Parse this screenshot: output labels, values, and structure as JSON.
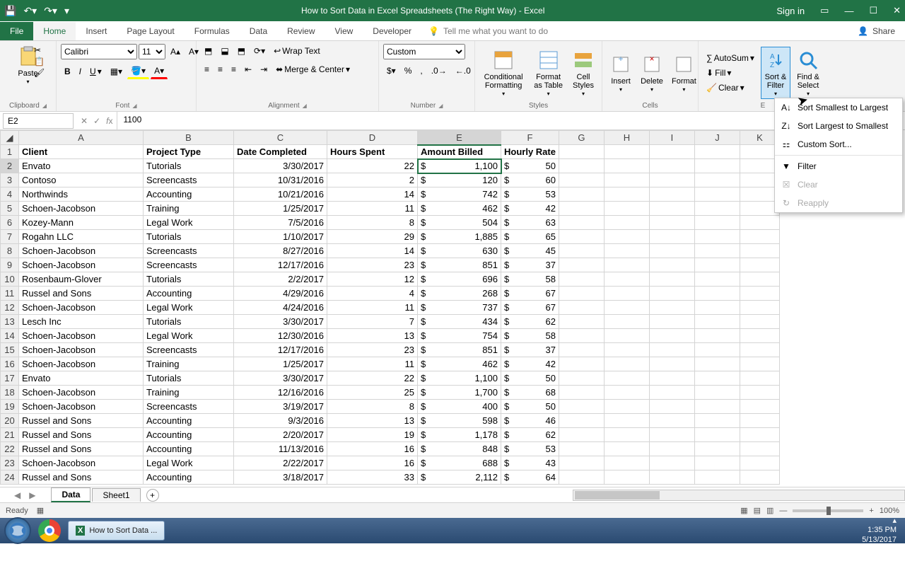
{
  "titlebar": {
    "title": "How to Sort Data in Excel Spreadsheets (The Right Way)  -  Excel",
    "signin": "Sign in"
  },
  "tabs": {
    "file": "File",
    "home": "Home",
    "insert": "Insert",
    "pagelayout": "Page Layout",
    "formulas": "Formulas",
    "data": "Data",
    "review": "Review",
    "view": "View",
    "developer": "Developer",
    "tellme": "Tell me what you want to do",
    "share": "Share"
  },
  "ribbon": {
    "clipboard": {
      "label": "Clipboard",
      "paste": "Paste"
    },
    "font": {
      "label": "Font",
      "name": "Calibri",
      "size": "11"
    },
    "alignment": {
      "label": "Alignment",
      "wrap": "Wrap Text",
      "merge": "Merge & Center"
    },
    "number": {
      "label": "Number",
      "format": "Custom"
    },
    "styles": {
      "label": "Styles",
      "cond": "Conditional Formatting",
      "table": "Format as Table",
      "cell": "Cell Styles"
    },
    "cells": {
      "label": "Cells",
      "insert": "Insert",
      "delete": "Delete",
      "format": "Format"
    },
    "editing": {
      "label": "E",
      "autosum": "AutoSum",
      "fill": "Fill",
      "clear": "Clear",
      "sort": "Sort & Filter",
      "find": "Find & Select"
    }
  },
  "sortmenu": {
    "asc": "Sort Smallest to Largest",
    "desc": "Sort Largest to Smallest",
    "custom": "Custom Sort...",
    "filter": "Filter",
    "clear": "Clear",
    "reapply": "Reapply"
  },
  "fbar": {
    "name": "E2",
    "value": "1100"
  },
  "columns": [
    "A",
    "B",
    "C",
    "D",
    "E",
    "F",
    "G",
    "H",
    "I",
    "J",
    "K"
  ],
  "headers": [
    "Client",
    "Project Type",
    "Date Completed",
    "Hours Spent",
    "Amount Billed",
    "Hourly Rate"
  ],
  "rows": [
    {
      "n": 2,
      "c": [
        "Envato",
        "Tutorials",
        "3/30/2017",
        "22",
        "1,100",
        "50"
      ]
    },
    {
      "n": 3,
      "c": [
        "Contoso",
        "Screencasts",
        "10/31/2016",
        "2",
        "120",
        "60"
      ]
    },
    {
      "n": 4,
      "c": [
        "Northwinds",
        "Accounting",
        "10/21/2016",
        "14",
        "742",
        "53"
      ]
    },
    {
      "n": 5,
      "c": [
        "Schoen-Jacobson",
        "Training",
        "1/25/2017",
        "11",
        "462",
        "42"
      ]
    },
    {
      "n": 6,
      "c": [
        "Kozey-Mann",
        "Legal Work",
        "7/5/2016",
        "8",
        "504",
        "63"
      ]
    },
    {
      "n": 7,
      "c": [
        "Rogahn LLC",
        "Tutorials",
        "1/10/2017",
        "29",
        "1,885",
        "65"
      ]
    },
    {
      "n": 8,
      "c": [
        "Schoen-Jacobson",
        "Screencasts",
        "8/27/2016",
        "14",
        "630",
        "45"
      ]
    },
    {
      "n": 9,
      "c": [
        "Schoen-Jacobson",
        "Screencasts",
        "12/17/2016",
        "23",
        "851",
        "37"
      ]
    },
    {
      "n": 10,
      "c": [
        "Rosenbaum-Glover",
        "Tutorials",
        "2/2/2017",
        "12",
        "696",
        "58"
      ]
    },
    {
      "n": 11,
      "c": [
        "Russel and Sons",
        "Accounting",
        "4/29/2016",
        "4",
        "268",
        "67"
      ]
    },
    {
      "n": 12,
      "c": [
        "Schoen-Jacobson",
        "Legal Work",
        "4/24/2016",
        "11",
        "737",
        "67"
      ]
    },
    {
      "n": 13,
      "c": [
        "Lesch Inc",
        "Tutorials",
        "3/30/2017",
        "7",
        "434",
        "62"
      ]
    },
    {
      "n": 14,
      "c": [
        "Schoen-Jacobson",
        "Legal Work",
        "12/30/2016",
        "13",
        "754",
        "58"
      ]
    },
    {
      "n": 15,
      "c": [
        "Schoen-Jacobson",
        "Screencasts",
        "12/17/2016",
        "23",
        "851",
        "37"
      ]
    },
    {
      "n": 16,
      "c": [
        "Schoen-Jacobson",
        "Training",
        "1/25/2017",
        "11",
        "462",
        "42"
      ]
    },
    {
      "n": 17,
      "c": [
        "Envato",
        "Tutorials",
        "3/30/2017",
        "22",
        "1,100",
        "50"
      ]
    },
    {
      "n": 18,
      "c": [
        "Schoen-Jacobson",
        "Training",
        "12/16/2016",
        "25",
        "1,700",
        "68"
      ]
    },
    {
      "n": 19,
      "c": [
        "Schoen-Jacobson",
        "Screencasts",
        "3/19/2017",
        "8",
        "400",
        "50"
      ]
    },
    {
      "n": 20,
      "c": [
        "Russel and Sons",
        "Accounting",
        "9/3/2016",
        "13",
        "598",
        "46"
      ]
    },
    {
      "n": 21,
      "c": [
        "Russel and Sons",
        "Accounting",
        "2/20/2017",
        "19",
        "1,178",
        "62"
      ]
    },
    {
      "n": 22,
      "c": [
        "Russel and Sons",
        "Accounting",
        "11/13/2016",
        "16",
        "848",
        "53"
      ]
    },
    {
      "n": 23,
      "c": [
        "Schoen-Jacobson",
        "Legal Work",
        "2/22/2017",
        "16",
        "688",
        "43"
      ]
    },
    {
      "n": 24,
      "c": [
        "Russel and Sons",
        "Accounting",
        "3/18/2017",
        "33",
        "2,112",
        "64"
      ]
    }
  ],
  "sheets": {
    "active": "Data",
    "other": "Sheet1"
  },
  "status": {
    "ready": "Ready",
    "zoom": "100%"
  },
  "taskbar": {
    "app": "How to Sort Data ...",
    "time": "1:35 PM",
    "date": "5/13/2017"
  }
}
